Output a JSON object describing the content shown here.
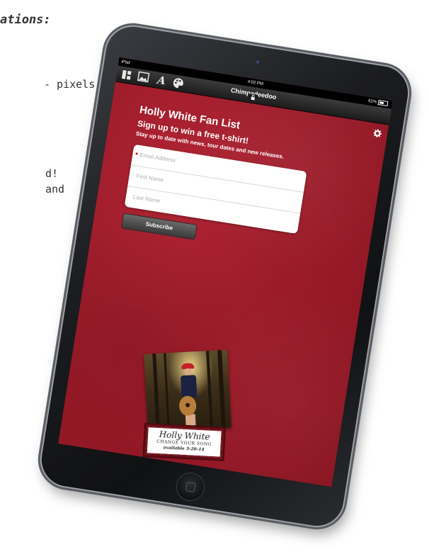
{
  "background_doc": {
    "title_fragment": "ations:",
    "line_pixels": "- pixels",
    "line_d": "d!",
    "line_and": "and"
  },
  "status_bar": {
    "carrier": "iPad",
    "time": "4:02 PM",
    "battery": "61%"
  },
  "toolbar": {
    "app_title": "Chimpadeedoo",
    "icons": [
      "layout-icon",
      "image-icon",
      "font-icon",
      "palette-icon"
    ]
  },
  "form": {
    "heading": "Holly White Fan List",
    "subheading": "Sign up to win a free t-shirt!",
    "description": "Stay up to date with news, tour dates and new releases.",
    "fields": [
      {
        "placeholder": "Email Address",
        "required": true
      },
      {
        "placeholder": "First Name",
        "required": false
      },
      {
        "placeholder": "Last Name",
        "required": false
      }
    ],
    "subscribe_label": "Subscribe"
  },
  "album": {
    "artist": "Holly White",
    "title": "CHANGE YOUR SONG",
    "release": "available 3-20-14"
  },
  "colors": {
    "screen_bg": "#9c1b2a",
    "toolbar_bg": "#1c1c1c",
    "button_bg": "#4a4a4a",
    "required_dot": "#cc0000"
  }
}
